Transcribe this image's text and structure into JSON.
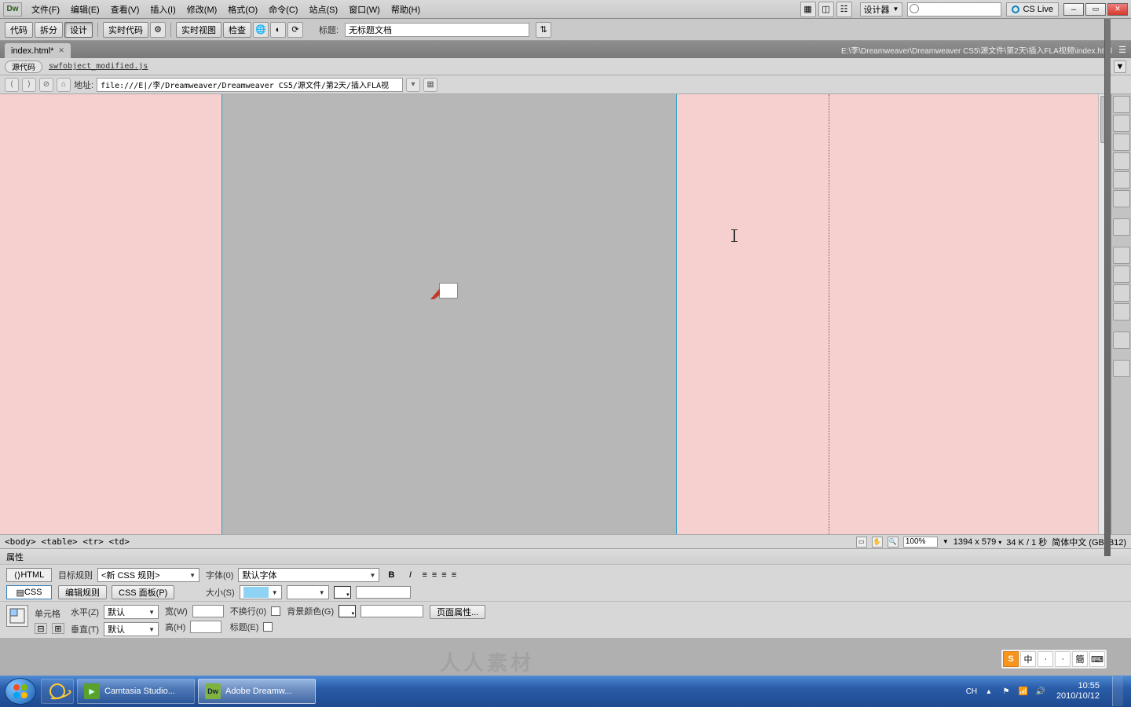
{
  "menu": {
    "items": [
      "文件(F)",
      "编辑(E)",
      "查看(V)",
      "插入(I)",
      "修改(M)",
      "格式(O)",
      "命令(C)",
      "站点(S)",
      "窗口(W)",
      "帮助(H)"
    ]
  },
  "layout_picker": "设计器",
  "cslive": "CS Live",
  "toolbar": {
    "code": "代码",
    "split": "拆分",
    "design": "设计",
    "livecode": "实时代码",
    "liveview": "实时视图",
    "inspect": "检查",
    "title_label": "标题:",
    "title_value": "无标题文档"
  },
  "doc": {
    "tab": "index.html*",
    "path": "E:\\李\\Dreamweaver\\Dreamweaver CS5\\源文件\\第2天\\插入FLA视频\\index.html"
  },
  "subbar": {
    "source_chip": "源代码",
    "related_file": "swfobject_modified.js"
  },
  "addr": {
    "label": "地址:",
    "value": "file:///E|/李/Dreamweaver/Dreamweaver CS5/源文件/第2天/插入FLA视"
  },
  "status": {
    "breadcrumb": "<body> <table> <tr> <td>",
    "zoom": "100%",
    "dims": "1394 x 579 ",
    "size_time": "34 K / 1 秒",
    "encoding": "简体中文 (GB2312)"
  },
  "props": {
    "title": "属性",
    "html": "HTML",
    "css": "CSS",
    "row1": {
      "target_rule_lbl": "目标规则",
      "target_rule_val": "<新 CSS 规则>",
      "edit_rule_btn": "编辑规则",
      "css_panel_btn": "CSS 面板(P)",
      "font_lbl": "字体(0)",
      "font_val": "默认字体",
      "size_lbl": "大小(S)"
    },
    "row2": {
      "cell_lbl": "单元格",
      "horiz_lbl": "水平(Z)",
      "horiz_val": "默认",
      "vert_lbl": "垂直(T)",
      "vert_val": "默认",
      "width_lbl": "宽(W)",
      "height_lbl": "高(H)",
      "nowrap_lbl": "不换行(0)",
      "header_lbl": "标题(E)",
      "bgcolor_lbl": "背景颜色(G)",
      "page_props_btn": "页面属性..."
    }
  },
  "taskbar": {
    "t1": "Camtasia Studio...",
    "t2": "Adobe Dreamw...",
    "lang": "CH",
    "time": "10:55",
    "date": "2010/10/12"
  },
  "ime": {
    "s1": "S",
    "s2": "中",
    "s3": "ᐧ",
    "s4": "ᐧ",
    "s5": "簡",
    "s6": "⌨"
  },
  "watermark": "人人素材"
}
